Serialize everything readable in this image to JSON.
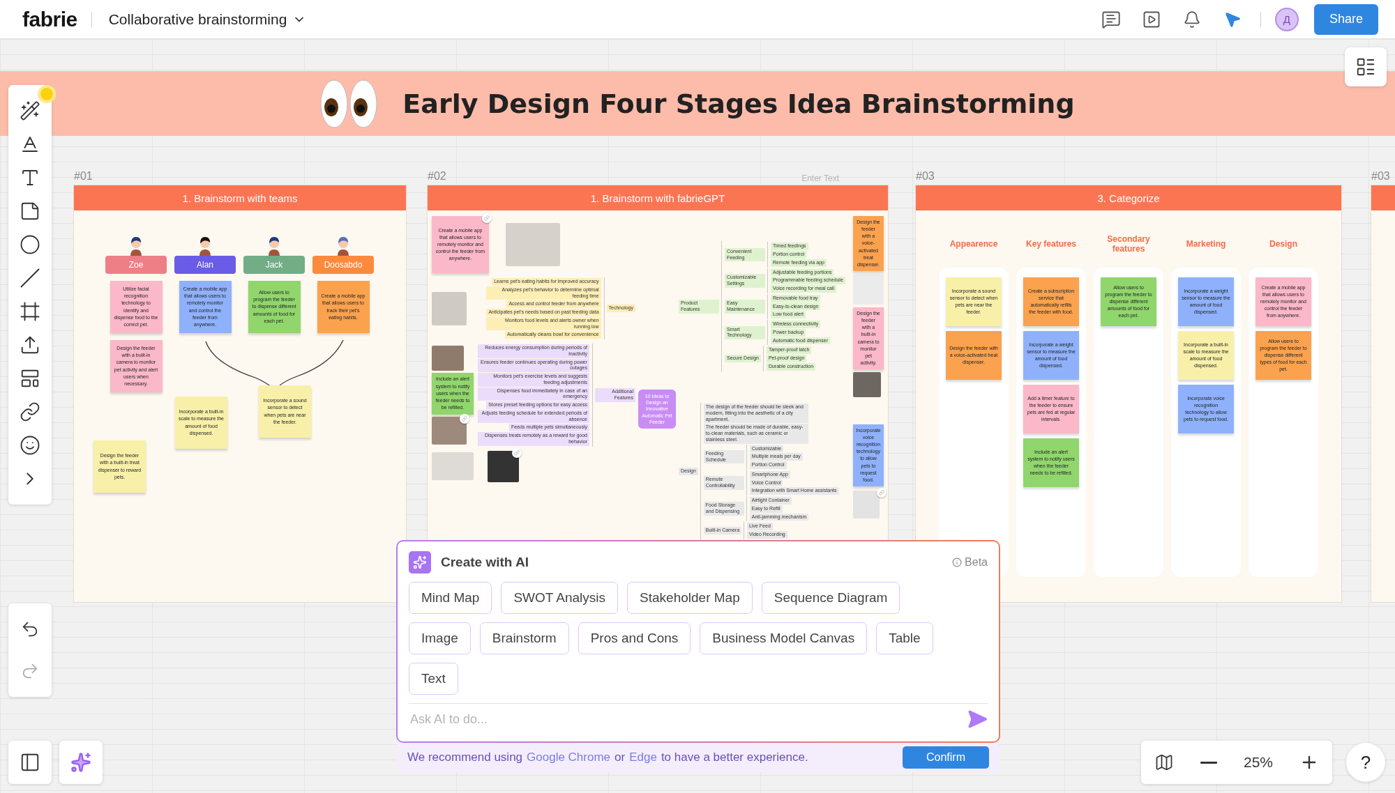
{
  "topbar": {
    "logo": "fabrie",
    "board_title": "Collaborative brainstorming",
    "avatar": "Д",
    "share": "Share"
  },
  "board_title_banner": {
    "title": "Early Design Four Stages Idea Brainstorming"
  },
  "frames": [
    {
      "kind": "team",
      "label": "#01",
      "title": "1. Brainstorm with teams",
      "members": [
        {
          "name": "Zoe",
          "color": "#ee7f86",
          "notes": [
            {
              "text": "Utilize facial recognition technology to identify and dispense food to the correct pet.",
              "color": "#fbb8c9"
            },
            {
              "text": "Design the feeder with a built-in camera to monitor pet activity and alert users when necessary.",
              "color": "#fbb8c9"
            }
          ]
        },
        {
          "name": "Alan",
          "color": "#6a5ce6",
          "notes": [
            {
              "text": "Create a mobile app that allows users to remotely monitor and control the feeder from anywhere.",
              "color": "#8fb1fb"
            }
          ]
        },
        {
          "name": "Jack",
          "color": "#72ad86",
          "notes": [
            {
              "text": "Allow users to program the feeder to dispense different amounts of food for each pet.",
              "color": "#90d66c"
            }
          ]
        },
        {
          "name": "Doosabdo",
          "color": "#fc8a3d",
          "notes": [
            {
              "text": "Create a mobile app that allows users to track their pet's eating habits.",
              "color": "#fba24f"
            }
          ]
        }
      ],
      "loose_notes": [
        {
          "text": "Incorporate a built-in scale to measure the amount of food dispensed.",
          "color": "#f8f0a9"
        },
        {
          "text": "Incorporate a sound sensor to detect when pets are near the feeder.",
          "color": "#f8f0a9"
        },
        {
          "text": "Design the feeder with a built-in treat dispenser to reward pets.",
          "color": "#f8f0a9"
        }
      ]
    },
    {
      "kind": "mindmap",
      "label": "#02",
      "hint": "Enter Text",
      "title": "1. Brainstorm with fabrieGPT",
      "notes": [
        {
          "text": "Create a mobile app that allows users to remotely monitor and control the feeder from anywhere.",
          "color": "#fbb8c9"
        },
        {
          "text": "Design the feeder with a voice-activated treat dispenser.",
          "color": "#fba24f"
        },
        {
          "text": "Design the feeder with a built-in camera to monitor pet activity.",
          "color": "#fbb8c9"
        },
        {
          "text": "Include an alert system to notify users when the feeder needs to be refilled.",
          "color": "#90d66c"
        },
        {
          "text": "Incorporate voice recognition technology to allow pets to request food.",
          "color": "#8fb1fb"
        }
      ],
      "mind_map": {
        "center": "10 Ideas to Design an Innovative Automatic Pet Feeder",
        "branches": [
          {
            "label": "Technology",
            "color": "#fdeeb5",
            "children": [
              {
                "label": "Learns pet's eating habits for improved accuracy"
              },
              {
                "label": "Analyzes pet's behavior to determine optimal feeding time"
              },
              {
                "label": "Access and control feeder from anywhere"
              },
              {
                "label": "Anticipates pet's needs based on past feeding data"
              },
              {
                "label": "Monitors food levels and alerts owner when running low"
              },
              {
                "label": "Automatically cleans bowl for convenience"
              }
            ]
          },
          {
            "label": "Additional Features",
            "color": "#ecdcfb",
            "children": [
              {
                "label": "Reduces energy consumption during periods of inactivity"
              },
              {
                "label": "Ensures feeder continues operating during power outages"
              },
              {
                "label": "Monitors pet's exercise levels and suggests feeding adjustments"
              },
              {
                "label": "Dispenses food immediately in case of an emergency"
              },
              {
                "label": "Stores preset feeding options for easy access"
              },
              {
                "label": "Adjusts feeding schedule for extended periods of absence"
              },
              {
                "label": "Feeds multiple pets simultaneously"
              },
              {
                "label": "Dispenses treats remotely as a reward for good behavior"
              }
            ]
          },
          {
            "label": "Product Features",
            "color": "#dff2cf",
            "children": [
              {
                "label": "Convenient Feeding",
                "children": [
                  {
                    "label": "Timed feedings"
                  },
                  {
                    "label": "Portion control"
                  },
                  {
                    "label": "Remote feeding via app"
                  }
                ]
              },
              {
                "label": "Customizable Settings",
                "children": [
                  {
                    "label": "Adjustable feeding portions"
                  },
                  {
                    "label": "Programmable feeding schedule"
                  },
                  {
                    "label": "Voice recording for meal call"
                  }
                ]
              },
              {
                "label": "Easy Maintenance",
                "children": [
                  {
                    "label": "Removable food tray"
                  },
                  {
                    "label": "Easy-to-clean design"
                  },
                  {
                    "label": "Low food alert"
                  }
                ]
              },
              {
                "label": "Smart Technology",
                "children": [
                  {
                    "label": "Wireless connectivity"
                  },
                  {
                    "label": "Power backup"
                  },
                  {
                    "label": "Automatic food dispenser"
                  }
                ]
              },
              {
                "label": "Secure Design",
                "children": [
                  {
                    "label": "Tamper-proof latch"
                  },
                  {
                    "label": "Pet-proof design"
                  },
                  {
                    "label": "Durable construction"
                  }
                ]
              }
            ]
          },
          {
            "label": "Design",
            "color": "#e8e8e8",
            "children": [
              {
                "label": "The design of the feeder should be sleek and modern, fitting into the aesthetic of a city apartment."
              },
              {
                "label": "The feeder should be made of durable, easy-to-clean materials, such as ceramic or stainless steel."
              },
              {
                "label": "Feeding Schedule",
                "children": [
                  {
                    "label": "Customizable"
                  },
                  {
                    "label": "Multiple meals per day"
                  },
                  {
                    "label": "Portion Control"
                  }
                ]
              },
              {
                "label": "Remote Controllability",
                "children": [
                  {
                    "label": "Smartphone App"
                  },
                  {
                    "label": "Voice Control"
                  },
                  {
                    "label": "Integration with Smart Home assistants"
                  }
                ]
              },
              {
                "label": "Food Storage and Dispensing",
                "children": [
                  {
                    "label": "Airtight Container"
                  },
                  {
                    "label": "Easy to Refill"
                  },
                  {
                    "label": "Anti-jamming mechanism"
                  }
                ]
              },
              {
                "label": "Built-in Camera",
                "children": [
                  {
                    "label": "Live Feed"
                  },
                  {
                    "label": "Video Recording"
                  }
                ]
              }
            ]
          }
        ]
      }
    },
    {
      "kind": "categories",
      "label": "#03",
      "title": "3. Categorize",
      "columns": [
        {
          "heading": "Appearence",
          "notes": [
            {
              "text": "Incorporate a sound sensor to detect when pets are near the feeder.",
              "color": "#f8f0a9"
            },
            {
              "text": "Design the feeder with a voice-activated treat dispenser.",
              "color": "#fba24f"
            }
          ]
        },
        {
          "heading": "Key features",
          "notes": [
            {
              "text": "Create a subscription service that automatically refills the feeder with food.",
              "color": "#fba24f"
            },
            {
              "text": "Incorporate a weight sensor to measure the amount of food dispensed.",
              "color": "#8fb1fb"
            },
            {
              "text": "Add a timer feature to the feeder to ensure pets are fed at regular intervals.",
              "color": "#fbb8c9"
            },
            {
              "text": "Include an alert system to notify users when the feeder needs to be refilled.",
              "color": "#90d66c"
            }
          ]
        },
        {
          "heading": "Secondary features",
          "notes": [
            {
              "text": "Allow users to program the feeder to dispense different amounts of food for each pet.",
              "color": "#90d66c"
            }
          ]
        },
        {
          "heading": "Marketing",
          "notes": [
            {
              "text": "Incorporate a weight sensor to measure the amount of food dispensed.",
              "color": "#8fb1fb"
            },
            {
              "text": "Incorporate a built-in scale to measure the amount of food dispensed.",
              "color": "#f8f0a9"
            },
            {
              "text": "Incorporate voice recognition technology to allow pets to request food.",
              "color": "#8fb1fb"
            }
          ]
        },
        {
          "heading": "Design",
          "notes": [
            {
              "text": "Create a mobile app that allows users to remotely monitor and control the feeder from anywhere.",
              "color": "#fbb8c9"
            },
            {
              "text": "Allow users to program the feeder to dispense different types of food for each pet.",
              "color": "#fba24f"
            }
          ]
        }
      ]
    },
    {
      "kind": "partial",
      "label": "#03"
    }
  ],
  "ai_panel": {
    "title": "Create with AI",
    "badge": "Beta",
    "option_rows": [
      [
        "Mind Map",
        "SWOT Analysis",
        "Stakeholder Map",
        "Sequence Diagram"
      ],
      [
        "Image",
        "Brainstorm",
        "Pros and Cons",
        "Business Model Canvas",
        "Table"
      ],
      [
        "Text"
      ]
    ],
    "placeholder": "Ask AI to do..."
  },
  "browser_notice": {
    "before": "We recommend using",
    "link_1": "Google Chrome",
    "middle": "or",
    "link_2": "Edge",
    "after": "to have a better experience.",
    "button": "Confirm"
  },
  "zoom_control": {
    "value": "25%"
  },
  "help": "?"
}
